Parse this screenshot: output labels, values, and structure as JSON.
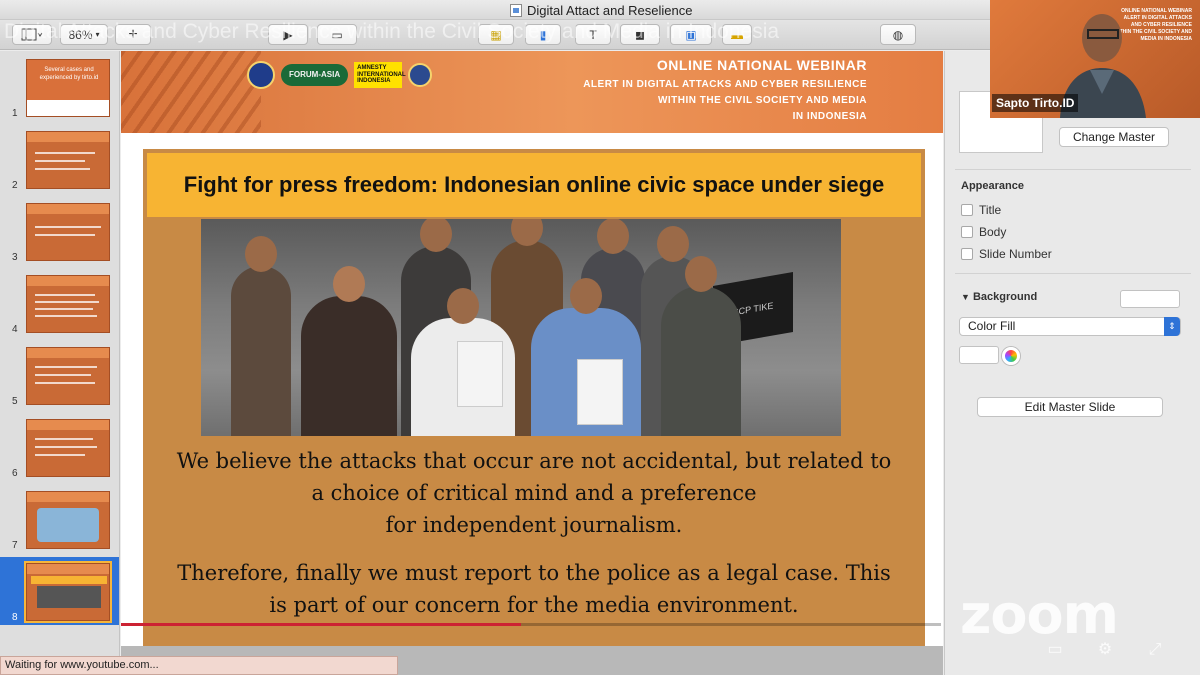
{
  "window": {
    "title": "Digital Attact and Reselience",
    "ghost_banner": "Digital Attacks and Cyber Resilience within the Civil Society and Media in Indonesia"
  },
  "toolbar": {
    "zoom_value": "86%",
    "add_label": "+"
  },
  "navigator": {
    "slides": [
      {
        "number": "1"
      },
      {
        "number": "2"
      },
      {
        "number": "3"
      },
      {
        "number": "4"
      },
      {
        "number": "5"
      },
      {
        "number": "6"
      },
      {
        "number": "7"
      },
      {
        "number": "8"
      }
    ],
    "selected_index": 8,
    "thumb1_text": "Several cases and experienced by tirto.id"
  },
  "slide": {
    "header_title": "ONLINE NATIONAL WEBINAR",
    "header_subtitle_1": "ALERT IN DIGITAL ATTACKS AND CYBER RESILIENCE",
    "header_subtitle_2": "WITHIN THE CIVIL SOCIETY AND MEDIA",
    "header_subtitle_3": "IN INDONESIA",
    "logo_forum": "FORUM-ASIA",
    "logo_amnesty": "AMNESTY INTERNATIONAL INDONESIA",
    "slide_title": "Fight for press freedom: Indonesian online civic space under siege",
    "photo_sign": "SCP TIKE",
    "paragraph_1_line_1": "We believe the attacks that occur are not accidental, but related to",
    "paragraph_1_line_2": "a choice of critical mind and a preference",
    "paragraph_1_line_3": "for independent journalism.",
    "paragraph_2_line_1": "Therefore, finally we must report to the police as a legal case. This",
    "paragraph_2_line_2": "is part of our concern for the media environment."
  },
  "inspector": {
    "change_master": "Change Master",
    "appearance_label": "Appearance",
    "checkboxes": [
      "Title",
      "Body",
      "Slide Number"
    ],
    "background_label": "Background",
    "fill_type": "Color Fill",
    "edit_master": "Edit Master Slide"
  },
  "zoom": {
    "participant_name": "Sapto Tirto.ID",
    "logo_text": "zoom",
    "video_bg_text": "ONLINE NATIONAL WEBINAR ALERT IN DIGITAL ATTACKS AND CYBER RESILIENCE WITHIN THE CIVIL SOCIETY AND MEDIA IN INDONESIA"
  },
  "status_bar": {
    "text": "Waiting for www.youtube.com..."
  },
  "colors": {
    "accent_blue": "#2e73d7",
    "slide_orange": "#e68b4e",
    "title_yellow": "#f7b433",
    "body_tan": "#c88a45"
  }
}
